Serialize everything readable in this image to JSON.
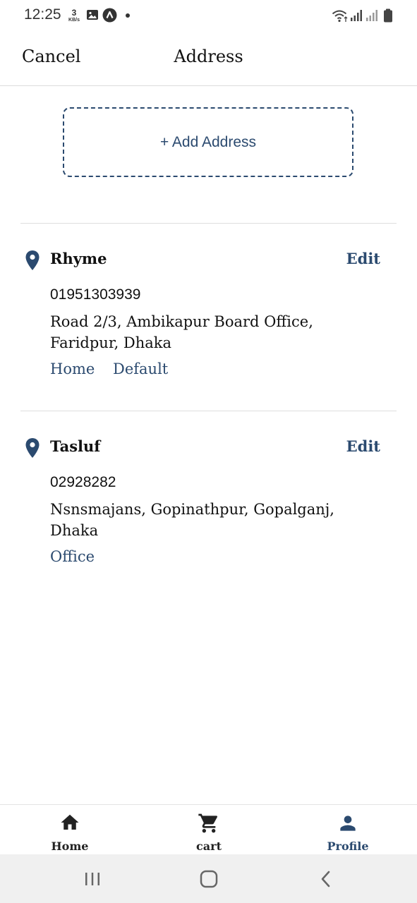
{
  "status_bar": {
    "time": "12:25",
    "net_speed_value": "3",
    "net_speed_unit": "KB/s",
    "icons": [
      "image-icon",
      "app-a-icon",
      "notification-dot",
      "wifi-icon",
      "signal-icon",
      "signal-2-icon",
      "battery-icon"
    ]
  },
  "header": {
    "cancel_label": "Cancel",
    "title": "Address"
  },
  "add_address": {
    "label": "+ Add Address"
  },
  "addresses": [
    {
      "name": "Rhyme",
      "edit_label": "Edit",
      "phone": "01951303939",
      "address": "Road 2/3, Ambikapur Board Office, Faridpur, Dhaka",
      "tags": [
        "Home",
        "Default"
      ]
    },
    {
      "name": "Tasluf",
      "edit_label": "Edit",
      "phone": "02928282",
      "address": "Nsnsmajans, Gopinathpur, Gopalganj, Dhaka",
      "tags": [
        "Office"
      ]
    }
  ],
  "bottom_nav": {
    "items": [
      {
        "label": "Home",
        "icon": "home-icon"
      },
      {
        "label": "cart",
        "icon": "cart-icon"
      },
      {
        "label": "Profile",
        "icon": "person-icon",
        "active": true
      }
    ]
  },
  "system_nav": {
    "icons": [
      "recent-apps-icon",
      "home-button-icon",
      "back-icon"
    ]
  },
  "colors": {
    "accent": "#2b4a6f",
    "divider": "#dedede",
    "system_nav_bg": "#f0f0f0"
  }
}
